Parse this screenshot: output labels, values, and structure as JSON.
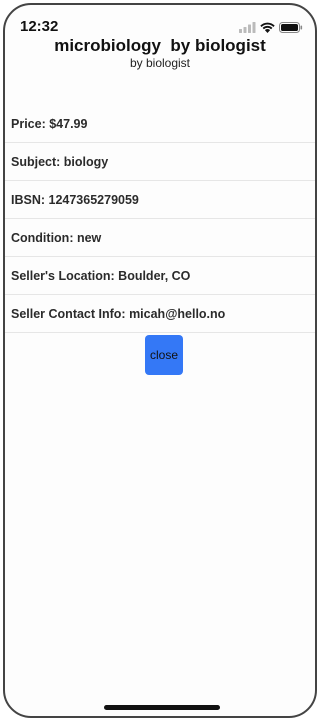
{
  "status_bar": {
    "time": "12:32",
    "icons": [
      "cellular-signal-icon",
      "wifi-icon",
      "battery-icon"
    ]
  },
  "header": {
    "title": "microbiology  by biologist",
    "subtitle": "by biologist"
  },
  "details": [
    {
      "label": "Price: $47.99"
    },
    {
      "label": "Subject: biology"
    },
    {
      "label": "IBSN: 1247365279059"
    },
    {
      "label": "Condition: new"
    },
    {
      "label": "Seller's Location: Boulder, CO"
    },
    {
      "label": "Seller Contact Info: micah@hello.no"
    }
  ],
  "actions": {
    "close_label": "close"
  },
  "colors": {
    "button_blue": "#3478f6",
    "divider": "#e6e6e6",
    "frame": "#444444"
  }
}
